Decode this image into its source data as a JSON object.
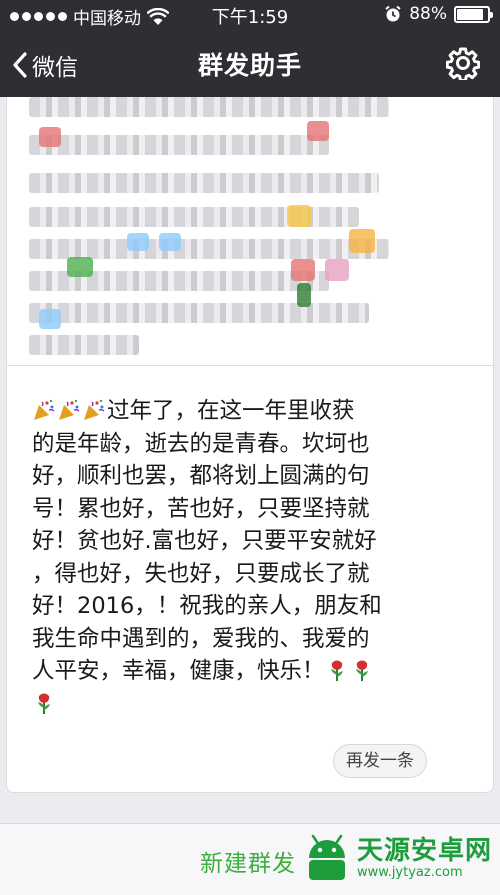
{
  "status_bar": {
    "carrier": "中国移动",
    "time": "下午1:59",
    "battery_text": "88%",
    "battery_level": 0.88,
    "signal_dots": 5
  },
  "nav": {
    "back_label": "微信",
    "title": "群发助手",
    "settings_icon": "gear-icon"
  },
  "message": {
    "lines": [
      "过年了，在这一年里收获",
      "的是年龄，逝去的是青春。坎坷也",
      "好，顺利也罢，都将划上圆满的句",
      "号！累也好，苦也好，只要坚持就",
      "好！贫也好.富也好，只要平安就好",
      "，得也好，失也好，只要成长了就",
      "好！2016，！祝我的亲人，朋友和",
      "我生命中遇到的，爱我的、我爱的",
      "人平安，幸福，健康，快乐！"
    ],
    "leading_emoji": [
      "party-popper-icon",
      "party-popper-icon",
      "party-popper-icon"
    ],
    "trailing_emoji": [
      "rose-icon",
      "rose-icon",
      "rose-icon"
    ],
    "resend_label": "再发一条"
  },
  "bottom": {
    "new_label": "新建群发"
  },
  "watermark": {
    "name": "天源安卓网",
    "url": "www.jytyaz.com"
  },
  "colors": {
    "topbar": "#2f2f33",
    "accent_green": "#3bb13b",
    "watermark_green": "#1e9d3c"
  }
}
